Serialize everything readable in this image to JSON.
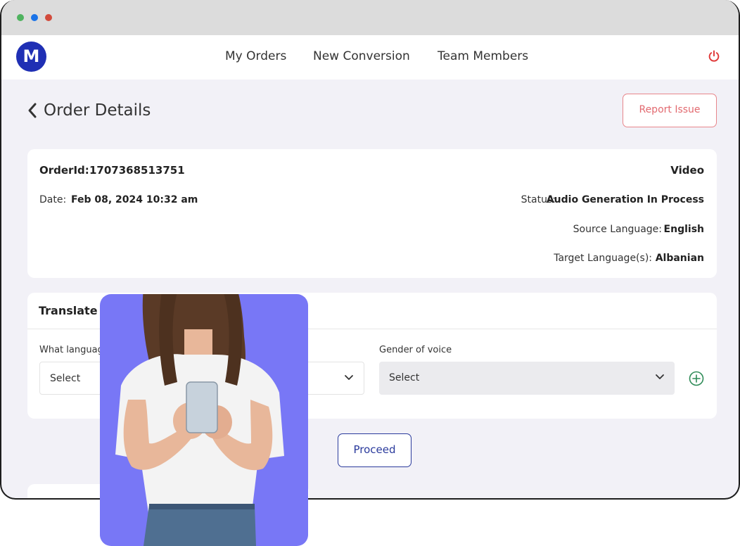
{
  "nav": {
    "logo_letter": "M",
    "items": [
      "My Orders",
      "New Conversion",
      "Team Members"
    ]
  },
  "page": {
    "title": "Order Details",
    "report_label": "Report Issue"
  },
  "order": {
    "id_label": "OrderId:",
    "id_value": "1707368513751",
    "type": "Video",
    "date_label": "Date:",
    "date_value": "Feb 08, 2024 10:32 am",
    "status_label": "Status:",
    "status_value": "Audio Generation In Process",
    "source_label": "Source Language:",
    "source_value": "English",
    "target_label": "Target Language(s):",
    "target_value": "Albanian"
  },
  "translate": {
    "heading": "Translate",
    "language_label": "What language",
    "language_value": "Select",
    "gender_label": "Gender of voice",
    "gender_value": "Select"
  },
  "proceed_label": "Proceed",
  "colors": {
    "brand": "#1f2fb4",
    "accent_red": "#e26a70",
    "photo_bg": "#7877f6"
  }
}
